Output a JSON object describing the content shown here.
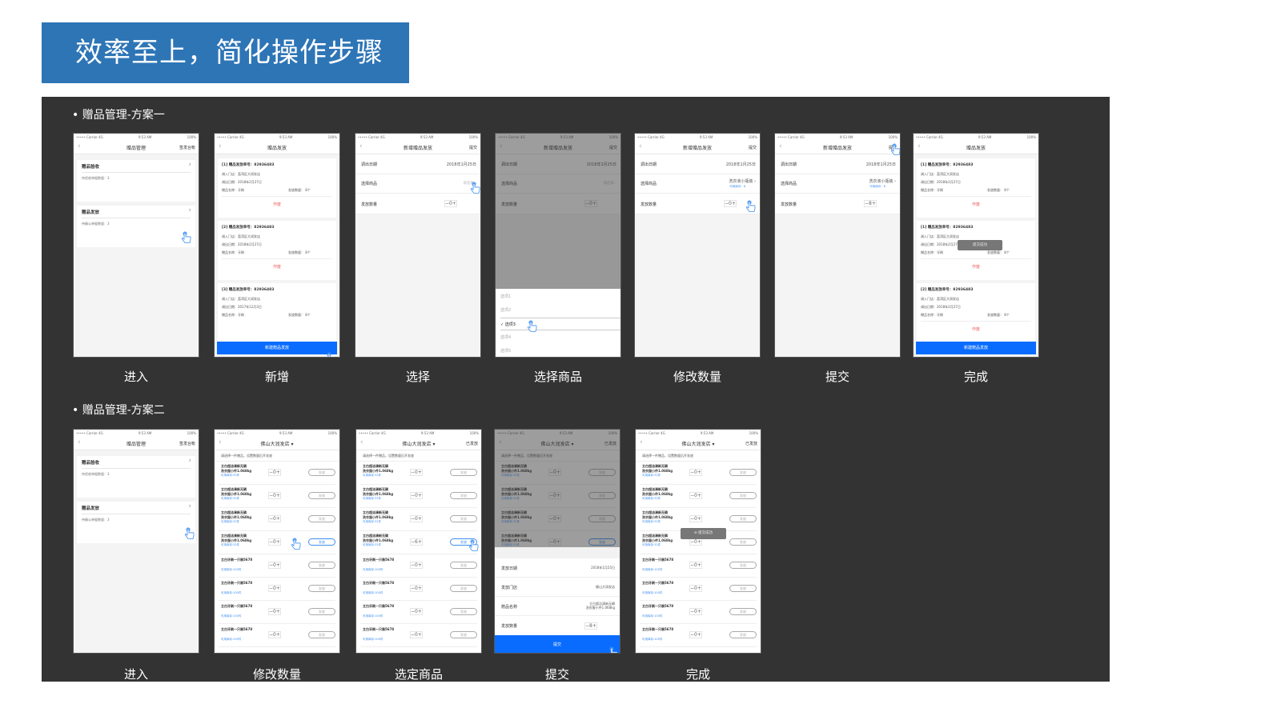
{
  "banner_title": "效率至上，简化操作步骤",
  "colors": {
    "banner": "#2e75b6",
    "panel": "#333333",
    "primary_button": "#0a6cff",
    "accent_text": "#3d8ef0",
    "void_text": "#f06060"
  },
  "status_bar": {
    "carrier": "••••• Carrier 4G",
    "time": "9:53 AM",
    "battery": "100%"
  },
  "common": {
    "back": "‹",
    "home": {
      "title": "赠品管理",
      "right": "签发台帐",
      "cards": [
        {
          "title": "赠品验收",
          "sub": "待验收单据数量：3"
        },
        {
          "title": "赠品发放",
          "sub": "待确认单据数量：3"
        }
      ]
    },
    "list": {
      "title": "赠品发放",
      "void": "作废",
      "new_button": "新建赠品发放",
      "records": [
        {
          "no": "[1]",
          "order": "赠品发放单号：82936483",
          "store": "调入门店：荔湾区大润发店",
          "date": "调出日期：2018年2月27日",
          "name": "赠品名称：牙刷",
          "qty": "发放数量：  8个"
        },
        {
          "no": "[2]",
          "order": "赠品发放单号：82936483",
          "store": "调入门店：荔湾区大润发店",
          "date": "调出日期：2018年2月27日",
          "name": "赠品名称：牙刷",
          "qty": "发放数量：  8个"
        },
        {
          "no": "[3]",
          "order": "赠品发放单号：82936483",
          "store": "调入门店：荔湾区大润发店",
          "date": "调出日期：2017年12月3日",
          "name": "赠品名称：牙刷",
          "qty": "发放数量：  8个"
        }
      ],
      "done_records": [
        {
          "no": "[1]",
          "order": "赠品发放单号：82936483",
          "store": "调入门店：荔湾区大润发店",
          "date": "调出日期：2018年2月27日",
          "name": "赠品名称：牙刷",
          "qty": "发放数量：  8个"
        },
        {
          "no": "[1]",
          "order": "赠品发放单号：82936483",
          "store": "调入门店：荔湾区大润发店",
          "date": "调出日期：2018年2月27日",
          "name": "赠品名称：牙刷",
          "qty": "发放数量：  8个"
        },
        {
          "no": "[2]",
          "order": "赠品发放单号：82936483",
          "store": "调入门店：荔湾区大润发店",
          "date": "调出日期：2018年2月27日",
          "name": "赠品名称：牙刷",
          "qty": "发放数量：  8个"
        }
      ]
    },
    "form": {
      "title": "新增赠品发放",
      "right": "提交",
      "date_label": "调出日期",
      "date_value": "2018年1月25日",
      "goods_label": "选择商品",
      "goods_placeholder": "请选择",
      "goods_value": "洗衣液小瓶装",
      "stock": "可用库存：8",
      "qty_label": "发放数量"
    },
    "picker": {
      "options": [
        "选项1",
        "选项2",
        "选项3",
        "选项4",
        "选项5"
      ],
      "selected": 2
    },
    "toast": "提交成功",
    "products": {
      "store": "佛山大润发店",
      "right": "已发放",
      "hint": "请选择一件赠品，设置数量后开发放",
      "button": "发放",
      "items": [
        {
          "name": "立白超洁清新无磷\n洗衣服小件1.068kg",
          "stock": "可用库存:32件"
        },
        {
          "name": "立白超洁清新无磷\n洗衣服小件1.068kg",
          "stock": "可用库存:32件"
        },
        {
          "name": "立白超洁清新无磷\n洗衣服小件1.068kg",
          "stock": "可用库存:32件"
        },
        {
          "name": "立白超洁清新无磷\n洗衣服小件1.068kg",
          "stock": "可用库存:32件"
        },
        {
          "name": "立白牙刷一只装5678",
          "stock": "可用库存:100件"
        },
        {
          "name": "立白牙刷一只装5678",
          "stock": "可用库存:100件"
        },
        {
          "name": "立白牙刷一只装5678",
          "stock": "可用库存:100件"
        },
        {
          "name": "立白牙刷一只装5678",
          "stock": "可用库存:100件"
        }
      ]
    },
    "sheet": {
      "rows": [
        {
          "label": "发放日期",
          "value": "2018年1月25日"
        },
        {
          "label": "发放门店",
          "value": "佛山大润发店"
        },
        {
          "label": "赠品名称",
          "value": "立白超洁清新无磷\n洗衣服小件1.068kg"
        }
      ],
      "qty_label": "发放数量",
      "qty": "8",
      "submit": "提交"
    }
  },
  "scheme1": {
    "label": "• 赠品管理-方案一",
    "screens": [
      {
        "type": "home",
        "caption": "进入"
      },
      {
        "type": "list",
        "caption": "新增"
      },
      {
        "type": "form",
        "caption": "选择",
        "selected": false,
        "qty": "0"
      },
      {
        "type": "form",
        "caption": "选择商品",
        "selected": false,
        "qty": "0",
        "picker": true
      },
      {
        "type": "form",
        "caption": "修改数量",
        "selected": true,
        "qty": "0"
      },
      {
        "type": "form",
        "caption": "提交",
        "selected": true,
        "qty": "8"
      },
      {
        "type": "list",
        "caption": "完成",
        "done": true
      }
    ]
  },
  "scheme2": {
    "label": "• 赠品管理-方案二",
    "screens": [
      {
        "type": "home",
        "caption": "进入"
      },
      {
        "type": "products",
        "caption": "修改数量",
        "active": 3,
        "qtys": [
          "0",
          "0",
          "0",
          "0",
          "0",
          "0",
          "0",
          "0"
        ],
        "right": false
      },
      {
        "type": "products",
        "caption": "选定商品",
        "active": 3,
        "qtys": [
          "0",
          "0",
          "0",
          "6",
          "0",
          "0",
          "0",
          "0"
        ],
        "right": true
      },
      {
        "type": "products",
        "caption": "提交",
        "active": 3,
        "qtys": [
          "0",
          "0",
          "0",
          "0",
          "0",
          "0",
          "0",
          "0"
        ],
        "right": true,
        "sheet": true
      },
      {
        "type": "products",
        "caption": "完成",
        "active": -1,
        "qtys": [
          "0",
          "0",
          "0",
          "0",
          "0",
          "0",
          "0",
          "0"
        ],
        "right": true,
        "toast": true
      }
    ]
  }
}
